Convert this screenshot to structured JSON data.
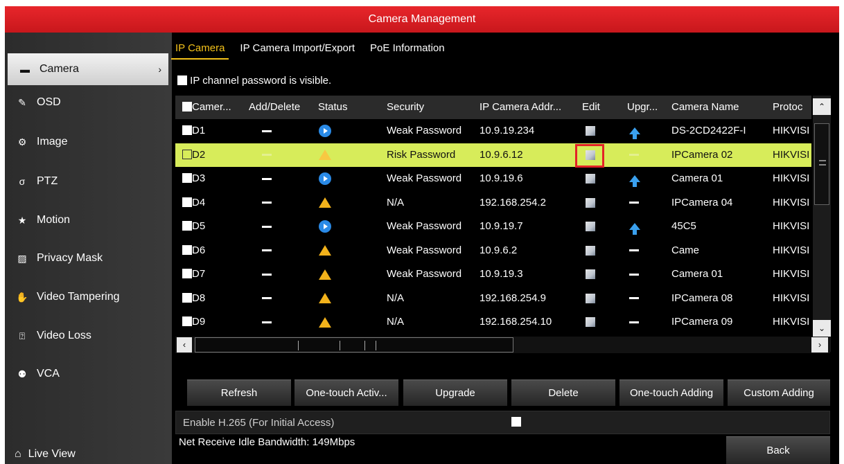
{
  "window": {
    "title": "Camera Management"
  },
  "sidebar": {
    "items": [
      {
        "label": "Camera",
        "icon": "camera-icon",
        "glyph": "▬",
        "active": true
      },
      {
        "label": "OSD",
        "icon": "osd-icon",
        "glyph": "✎"
      },
      {
        "label": "Image",
        "icon": "image-icon",
        "glyph": "⚙"
      },
      {
        "label": "PTZ",
        "icon": "ptz-icon",
        "glyph": "σ"
      },
      {
        "label": "Motion",
        "icon": "motion-icon",
        "glyph": "★"
      },
      {
        "label": "Privacy Mask",
        "icon": "privacy-mask-icon",
        "glyph": "▨"
      },
      {
        "label": "Video Tampering",
        "icon": "video-tampering-icon",
        "glyph": "✋"
      },
      {
        "label": "Video Loss",
        "icon": "video-loss-icon",
        "glyph": "⍰"
      },
      {
        "label": "VCA",
        "icon": "vca-icon",
        "glyph": "⚉"
      }
    ],
    "live_view": {
      "label": "Live View",
      "icon": "home-icon",
      "glyph": "⌂"
    }
  },
  "tabs": [
    {
      "label": "IP Camera",
      "active": true
    },
    {
      "label": "IP Camera Import/Export"
    },
    {
      "label": "PoE Information"
    }
  ],
  "password_visible": {
    "label": "IP channel password is visible.",
    "checked": false
  },
  "table": {
    "columns": [
      "Camer...",
      "Add/Delete",
      "Status",
      "Security",
      "IP Camera Addr...",
      "Edit",
      "Upgr...",
      "Camera Name",
      "Protoc"
    ],
    "rows": [
      {
        "camera": "D1",
        "status": "play",
        "security": "Weak Password",
        "ip": "10.9.19.234",
        "upgrade": true,
        "name": "DS-2CD2422F-I",
        "protocol": "HIKVISION"
      },
      {
        "camera": "D2",
        "status": "warn",
        "security": "Risk Password",
        "ip": "10.9.6.12",
        "upgrade": false,
        "name": "IPCamera 02",
        "protocol": "HIKVISION",
        "highlight": true
      },
      {
        "camera": "D3",
        "status": "play",
        "security": "Weak Password",
        "ip": "10.9.19.6",
        "upgrade": true,
        "name": "Camera 01",
        "protocol": "HIKVISION"
      },
      {
        "camera": "D4",
        "status": "warn",
        "security": "N/A",
        "ip": "192.168.254.2",
        "upgrade": false,
        "name": "IPCamera 04",
        "protocol": "HIKVISION"
      },
      {
        "camera": "D5",
        "status": "play",
        "security": "Weak Password",
        "ip": "10.9.19.7",
        "upgrade": true,
        "name": "45C5",
        "protocol": "HIKVISION"
      },
      {
        "camera": "D6",
        "status": "warn",
        "security": "Weak Password",
        "ip": "10.9.6.2",
        "upgrade": false,
        "name": "Came",
        "protocol": "HIKVISION"
      },
      {
        "camera": "D7",
        "status": "warn",
        "security": "Weak Password",
        "ip": "10.9.19.3",
        "upgrade": false,
        "name": "Camera 01",
        "protocol": "HIKVISION"
      },
      {
        "camera": "D8",
        "status": "warn",
        "security": "N/A",
        "ip": "192.168.254.9",
        "upgrade": false,
        "name": "IPCamera 08",
        "protocol": "HIKVISION"
      },
      {
        "camera": "D9",
        "status": "warn",
        "security": "N/A",
        "ip": "192.168.254.10",
        "upgrade": false,
        "name": "IPCamera 09",
        "protocol": "HIKVISION"
      }
    ]
  },
  "buttons": {
    "refresh": "Refresh",
    "one_touch_activate": "One-touch Activ...",
    "upgrade": "Upgrade",
    "delete": "Delete",
    "one_touch_adding": "One-touch Adding",
    "custom_adding": "Custom Adding",
    "back": "Back"
  },
  "h265": {
    "label": "Enable H.265 (For Initial Access)",
    "checked": false
  },
  "bandwidth": "Net Receive Idle Bandwidth: 149Mbps",
  "colors": {
    "title_red": "#d61f24",
    "highlight": "#d7ec5a",
    "active_tab": "#f4c21a"
  }
}
